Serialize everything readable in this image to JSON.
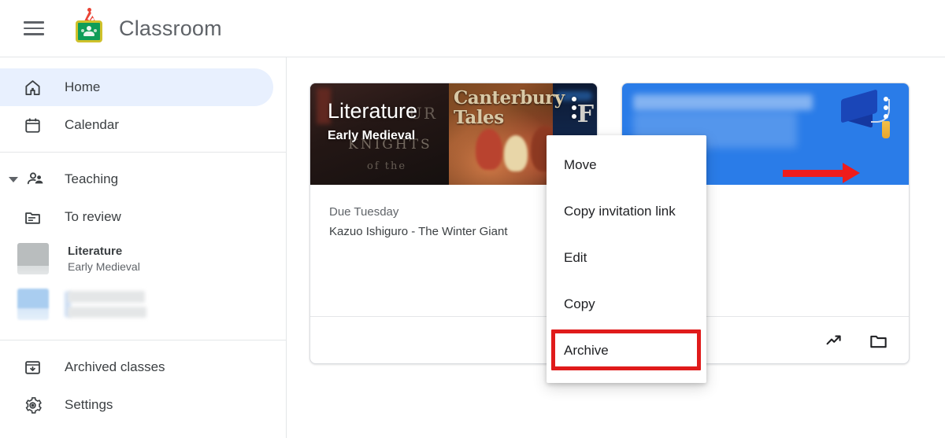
{
  "app": {
    "title": "Classroom",
    "logo_icon": "classroom-logo-with-party-hat",
    "menu_icon": "hamburger-menu-icon"
  },
  "sidebar": {
    "nav": [
      {
        "label": "Home",
        "icon": "home-icon",
        "active": true
      },
      {
        "label": "Calendar",
        "icon": "calendar-icon",
        "active": false
      }
    ],
    "group": {
      "label": "Teaching",
      "icon": "teaching-people-icon",
      "caret": "chevron-down-icon",
      "expanded": true
    },
    "group_items": [
      {
        "label": "To review",
        "icon": "to-review-folder-icon"
      }
    ],
    "classes": [
      {
        "title": "Literature",
        "subtitle": "Early Medieval",
        "thumb": "gray",
        "redacted": false
      },
      {
        "title": "",
        "subtitle": "",
        "thumb": "blue",
        "redacted": true
      }
    ],
    "bottom": [
      {
        "label": "Archived classes",
        "icon": "archive-box-icon"
      },
      {
        "label": "Settings",
        "icon": "gear-icon"
      }
    ]
  },
  "cards": [
    {
      "banner_title": "Literature",
      "banner_subtitle": "Early Medieval",
      "cover_text": {
        "main": "Canterbury Tales",
        "knights": "KNIGHTS",
        "ofthe": "of the",
        "ur": "UR",
        "f": "F"
      },
      "due": "Due Tuesday",
      "assignment": "Kazuo Ishiguro - The Winter Giant",
      "overflow_icon": "three-dot-menu-icon",
      "footer_icons": [
        "open-work-trending-icon"
      ]
    },
    {
      "banner_title": "",
      "banner_subtitle": "",
      "redacted_word": "Literature",
      "due": "",
      "assignment": "",
      "overflow_icon": "three-dot-menu-icon",
      "footer_icons": [
        "open-work-trending-icon",
        "folder-icon"
      ],
      "decoration": "graduation-cap-icon"
    }
  ],
  "context_menu": {
    "items": [
      {
        "label": "Move",
        "highlighted": false
      },
      {
        "label": "Copy invitation link",
        "highlighted": false
      },
      {
        "label": "Edit",
        "highlighted": false
      },
      {
        "label": "Copy",
        "highlighted": false
      },
      {
        "label": "Archive",
        "highlighted": true
      }
    ]
  },
  "annotations": {
    "arrow_color": "#ee1c1c",
    "highlight_box_color": "#e01b1b",
    "arrow_points_to": "three-dot-menu-icon"
  },
  "colors": {
    "accent_blue": "#2a7ce8",
    "sidebar_active": "#e8f0fe",
    "text_primary": "#3c4043",
    "text_secondary": "#5f6368",
    "logo_green": "#0f9d58"
  }
}
